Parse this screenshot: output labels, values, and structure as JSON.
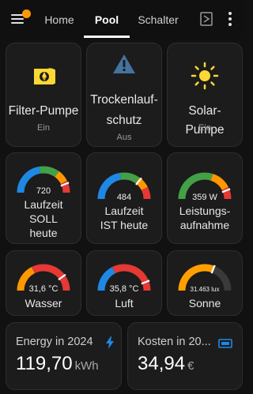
{
  "header": {
    "tabs": [
      {
        "label": "Home"
      },
      {
        "label": "Pool"
      },
      {
        "label": "Schalter"
      }
    ],
    "active_tab": "Pool"
  },
  "buttons": [
    {
      "name": "Filter-Pumpe",
      "state": "Ein",
      "icon": "pump-icon",
      "color": "#fdd835"
    },
    {
      "name_line1": "Trockenlauf-",
      "name_line2": "schutz",
      "state": "Aus",
      "icon": "alert-icon",
      "color": "#44739e"
    },
    {
      "name": "Solar-Pumpe",
      "state": "Ein",
      "icon": "sun-icon",
      "color": "#fdd835"
    }
  ],
  "gauges": [
    {
      "value_text": "720",
      "value": 0.88,
      "label_lines": [
        "Laufzeit",
        "SOLL",
        "heute"
      ]
    },
    {
      "value_text": "484",
      "value": 0.72,
      "label_lines": [
        "Laufzeit",
        "IST heute"
      ]
    },
    {
      "value_text": "359 W",
      "value": 0.88,
      "label_lines": [
        "Leistungs-",
        "aufnahme"
      ]
    },
    {
      "value_text": "31,6 °C",
      "value": 0.8,
      "label_lines": [
        "Wasser"
      ]
    },
    {
      "value_text": "35,8 °C",
      "value": 0.88,
      "label_lines": [
        "Luft"
      ]
    },
    {
      "value_text": "31.463 lux",
      "value": 0.62,
      "label_lines": [
        "Sonne"
      ]
    }
  ],
  "energy": {
    "title": "Energy in 2024",
    "value": "119,70",
    "unit": "kWh",
    "icon": "lightning-bolt-icon"
  },
  "costs": {
    "title": "Kosten in 20...",
    "value": "34,94",
    "unit": "€",
    "icon": "cash-icon"
  },
  "colors": {
    "on_yellow": "#fdd835",
    "off_blue": "#44739e",
    "gauge_blue": "#1e88e5",
    "gauge_green": "#43a047",
    "gauge_orange": "#ff9800",
    "gauge_red": "#e53935",
    "sun_orange": "#ffa000",
    "track": "#3a3a3a"
  }
}
